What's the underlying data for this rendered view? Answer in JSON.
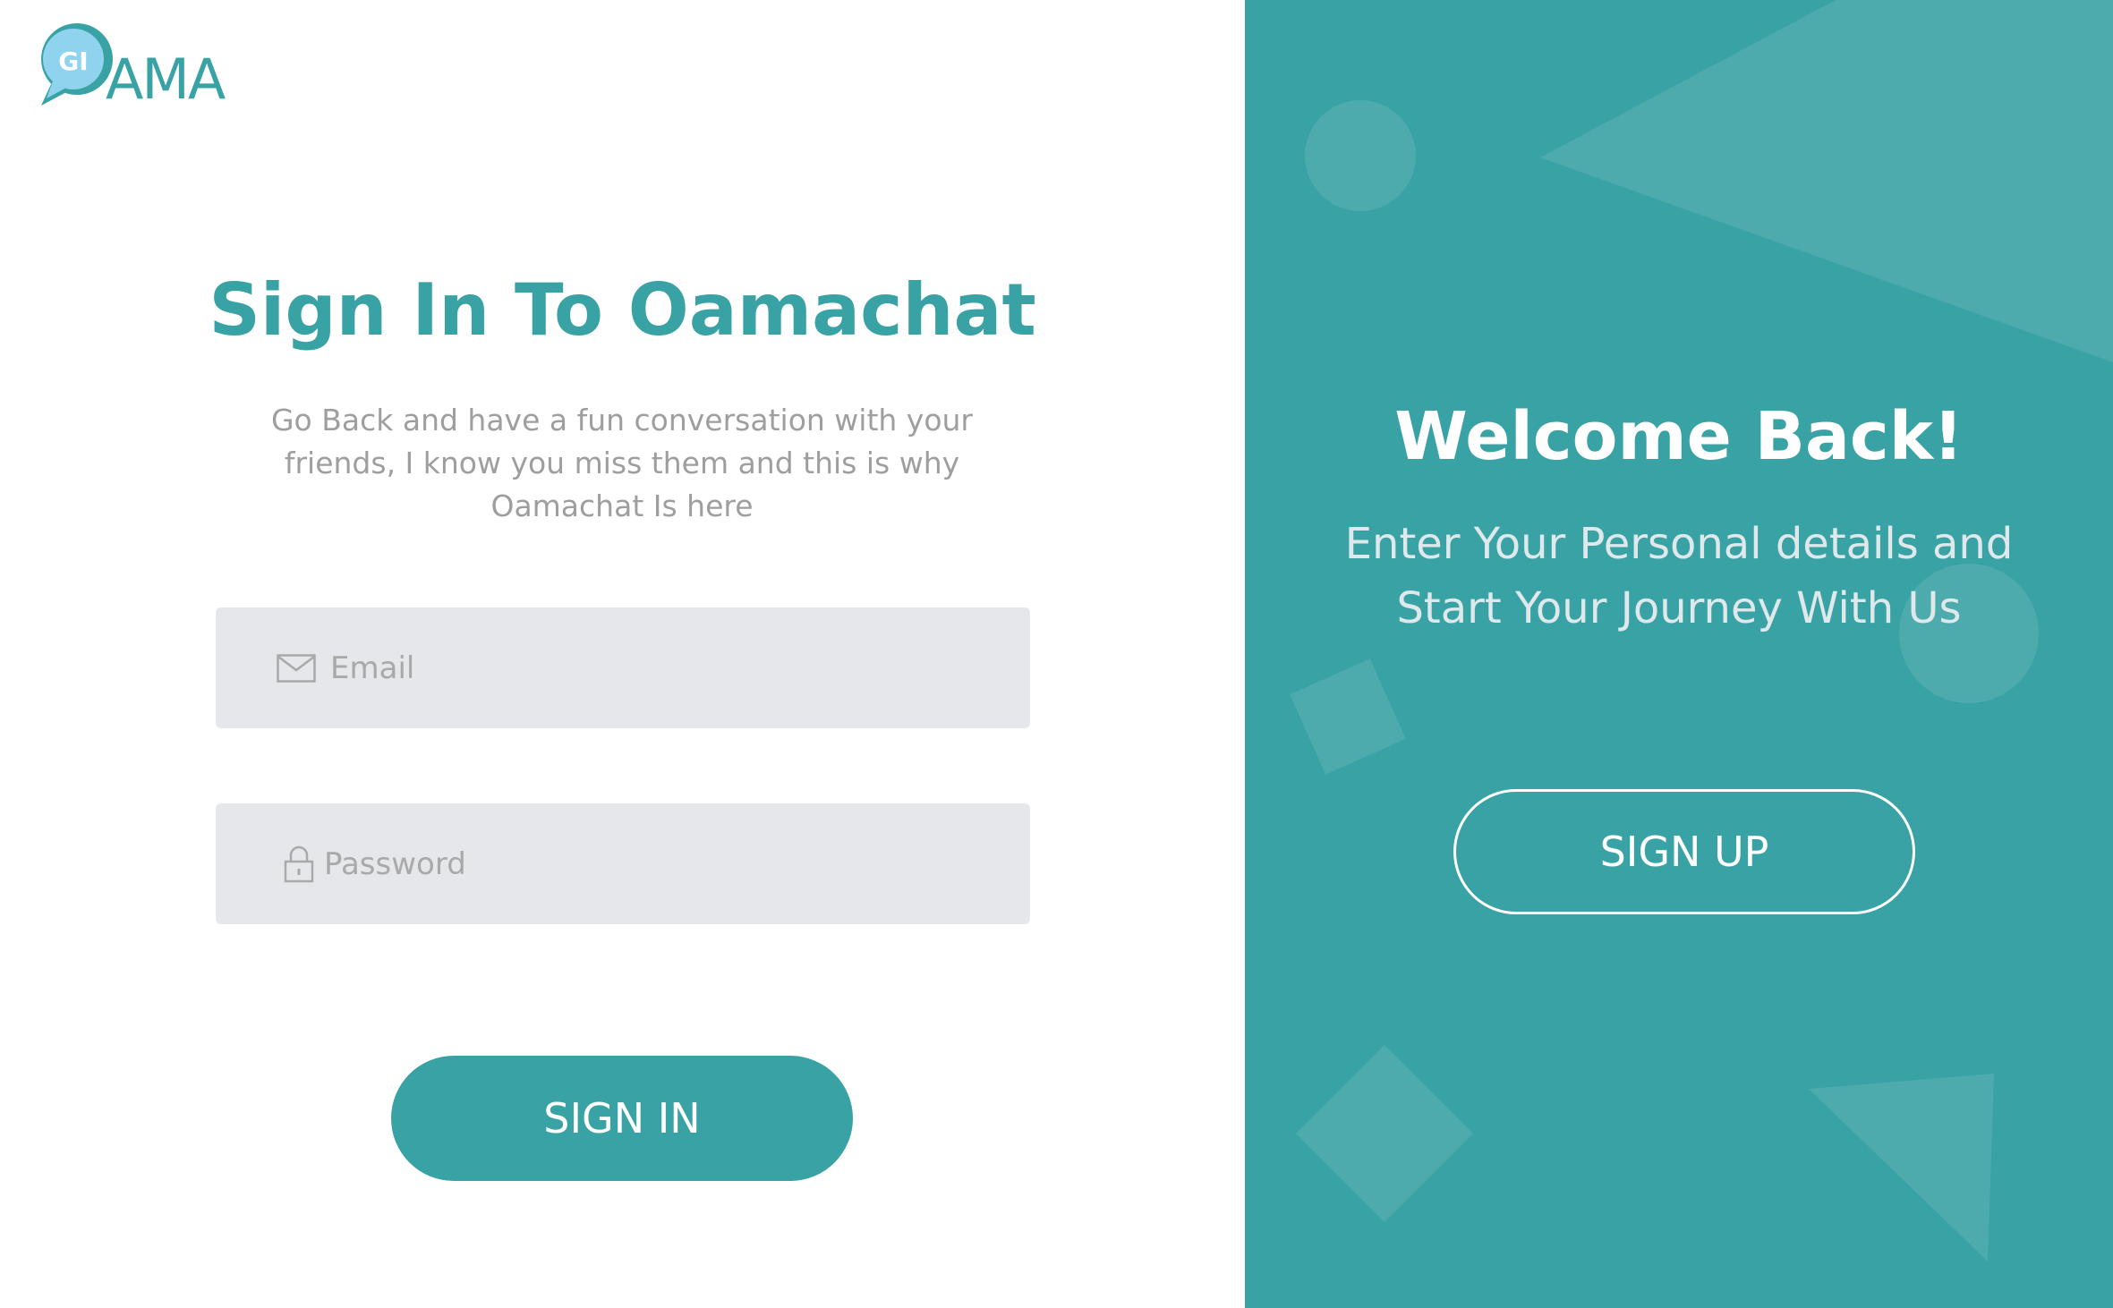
{
  "logo": {
    "badge_text": "GI",
    "wordmark": "AMA"
  },
  "signin": {
    "title": "Sign In To Oamachat",
    "subtitle_lines": [
      "Go Back and have a fun conversation with your",
      "friends, I know you miss them  and this is why",
      "Oamachat Is here"
    ],
    "email": {
      "placeholder": "Email",
      "value": "",
      "icon": "envelope-icon"
    },
    "password": {
      "placeholder": "Password",
      "value": "",
      "icon": "lock-icon"
    },
    "button_label": "SIGN IN"
  },
  "signup_panel": {
    "title": "Welcome Back!",
    "subtitle_lines": [
      "Enter Your Personal details and",
      "Start Your Journey With Us"
    ],
    "button_label": "SIGN UP"
  },
  "colors": {
    "accent": "#39a2a5",
    "field_bg": "#e5e7eb",
    "muted_text": "#9e9e9e",
    "logo_bubble": "#8fd3ef"
  }
}
